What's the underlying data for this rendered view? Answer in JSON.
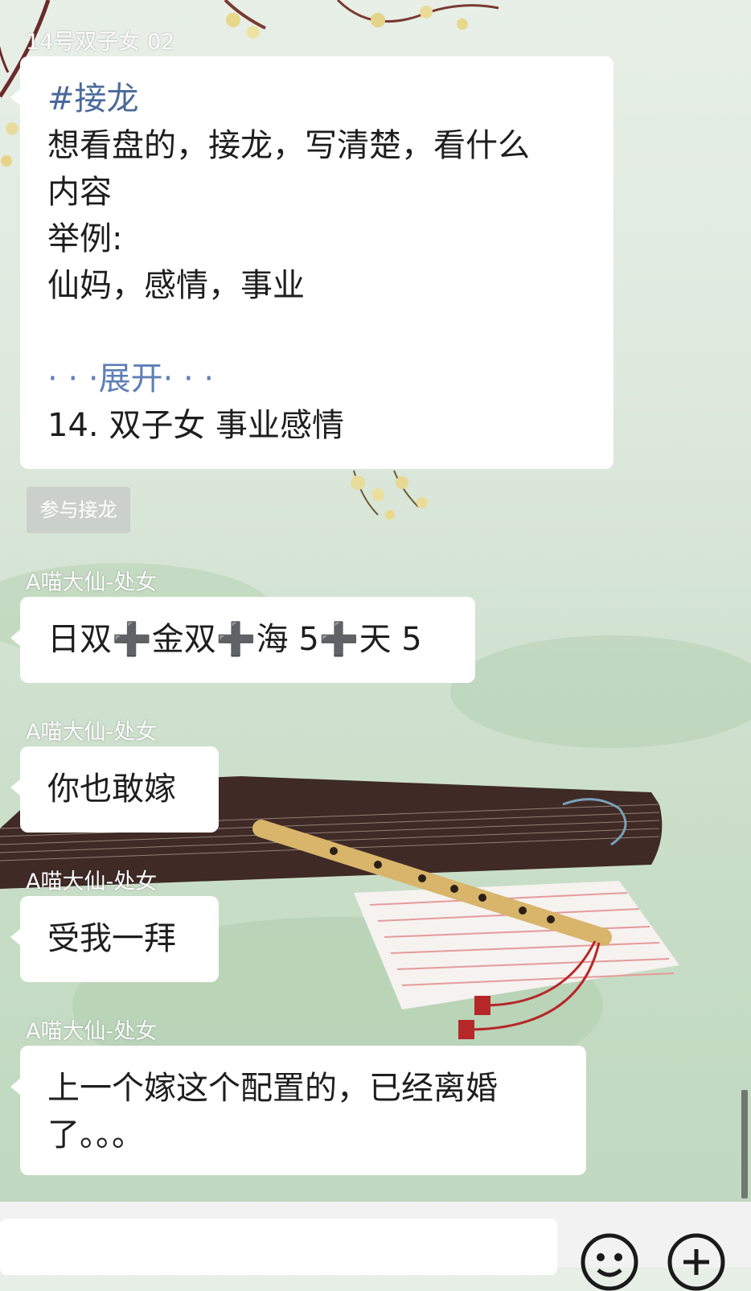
{
  "messages": [
    {
      "sender": "14号双子女  02",
      "lines": [
        "#接龙",
        "想看盘的，接龙，写清楚，看什么",
        "内容",
        "举例:",
        "仙妈，感情，事业",
        "",
        "· · ·展开· · ·",
        "14. 双子女  事业感情"
      ]
    },
    {
      "sender": "A喵大仙-处女",
      "lines": [
        "日双➕金双➕海 5➕天 5"
      ]
    },
    {
      "sender": "A喵大仙-处女",
      "lines": [
        "你也敢嫁"
      ]
    },
    {
      "sender": "A喵大仙-处女",
      "lines": [
        "受我一拜"
      ]
    },
    {
      "sender": "A喵大仙-处女",
      "lines": [
        "上一个嫁这个配置的，已经离婚",
        "了。。。"
      ]
    }
  ],
  "join_button": "参与接龙",
  "icons": [
    "emoji-icon",
    "plus-icon"
  ],
  "colors": {
    "hashtag": "#4a6a9a",
    "expand": "#5f7fb5",
    "bubble": "#ffffff"
  }
}
